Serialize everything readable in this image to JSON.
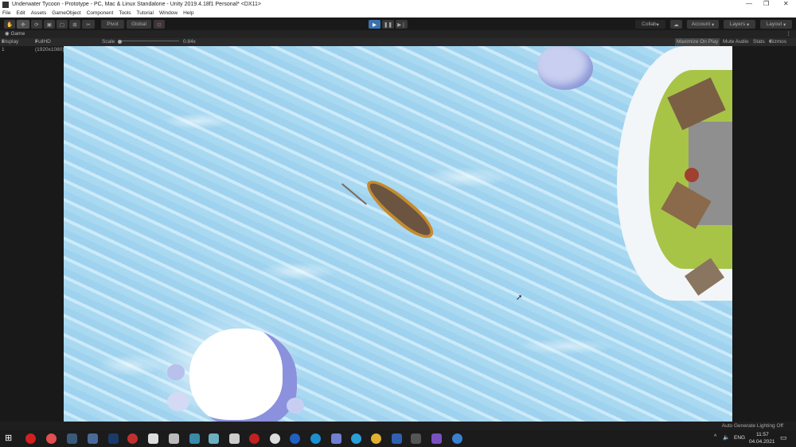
{
  "window": {
    "title": "Underwater Tycoon - Prototype - PC, Mac & Linux Standalone - Unity 2019.4.18f1 Personal* <DX11>",
    "minimize": "—",
    "restore": "❐",
    "close": "✕"
  },
  "menu": [
    "File",
    "Edit",
    "Assets",
    "GameObject",
    "Component",
    "Tools",
    "Tutorial",
    "Window",
    "Help"
  ],
  "toolbar": {
    "pivot": "Pivot",
    "global": "Global",
    "collab": "Collab",
    "account": "Account",
    "layers": "Layers",
    "layout": "Layout"
  },
  "game": {
    "tab": "Game",
    "display": "Display 1",
    "resolution": "FullHD (1920x1080)",
    "scale_label": "Scale",
    "scale_value": "0.84x",
    "maximize": "Maximize On Play",
    "mute": "Mute Audio",
    "stats": "Stats",
    "gizmos": "Gizmos"
  },
  "status": {
    "lighting": "Auto Generate Lighting Off"
  },
  "taskbar": {
    "lang": "ENG",
    "time": "11:57",
    "date": "04.04.2021"
  },
  "colors": {
    "accent": "#3a72b0",
    "water": "#aadaf2"
  }
}
